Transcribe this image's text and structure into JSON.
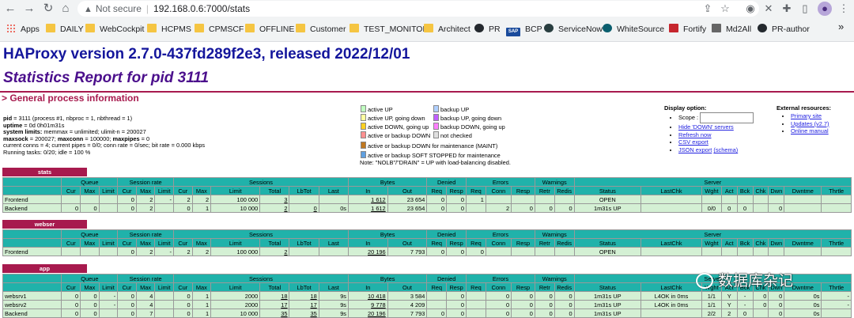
{
  "browser": {
    "back_icon": "arrow-left-icon",
    "url_scheme_warning": "Not secure",
    "url": "192.168.0.6:7000/stats",
    "bookmarks": [
      {
        "label": "Apps",
        "icon": "apps-grid-icon"
      },
      {
        "label": "DAILY",
        "icon": "folder-icon"
      },
      {
        "label": "WebCockpit",
        "icon": "folder-icon"
      },
      {
        "label": "HCPMS",
        "icon": "folder-icon"
      },
      {
        "label": "CPMSCF",
        "icon": "folder-icon"
      },
      {
        "label": "OFFLINE",
        "icon": "folder-icon"
      },
      {
        "label": "Customer",
        "icon": "folder-icon"
      },
      {
        "label": "TEST_MONITOR",
        "icon": "folder-icon"
      },
      {
        "label": "Architect",
        "icon": "folder-icon"
      },
      {
        "label": "PR",
        "icon": "github-icon"
      },
      {
        "label": "BCP",
        "icon": "sap-icon"
      },
      {
        "label": "ServiceNow",
        "icon": "servicenow-icon"
      },
      {
        "label": "WhiteSource",
        "icon": "whitesource-icon"
      },
      {
        "label": "Fortify",
        "icon": "fortify-icon"
      },
      {
        "label": "Md2All",
        "icon": "md2all-icon"
      },
      {
        "label": "PR-author",
        "icon": "github-icon"
      }
    ],
    "more_bookmarks": "»",
    "sap_label": "SAP"
  },
  "page": {
    "title": "HAProxy version 2.7.0-437fd289f2e3, released 2022/12/01",
    "subtitle": "Statistics Report for pid 3111",
    "section_title": "> General process information"
  },
  "process_info": {
    "line1_key": "pid",
    "line1_val": " = 3111 (process #1, nbproc = 1, nbthread = 1)",
    "line2_key": "uptime",
    "line2_val": " = 0d 0h01m31s",
    "line3_key": "system limits:",
    "line3_val": " memmax = unlimited; ulimit-n = 200027",
    "line4_key1": "maxsock",
    "line4_val1": " = 200027; ",
    "line4_key2": "maxconn",
    "line4_val2": " = 100000; ",
    "line4_key3": "maxpipes",
    "line4_val3": " = 0",
    "line5": "current conns = 4; current pipes = 0/0; conn rate = 0/sec; bit rate = 0.000 kbps",
    "line6": "Running tasks: 0/20; idle = 100 %"
  },
  "legend": {
    "items": [
      {
        "label": "active UP",
        "color": "#c0ffc0"
      },
      {
        "label": "backup UP",
        "color": "#b0d0ff"
      },
      {
        "label": "active UP, going down",
        "color": "#ffffa0"
      },
      {
        "label": "backup UP, going down",
        "color": "#c060ff"
      },
      {
        "label": "active DOWN, going up",
        "color": "#ffd020"
      },
      {
        "label": "backup DOWN, going up",
        "color": "#ff80ff"
      },
      {
        "label": "active or backup DOWN",
        "color": "#ff9090"
      },
      {
        "label": "not checked",
        "color": "#e0e0e0"
      },
      {
        "label": "active or backup DOWN for maintenance (MAINT)",
        "color": "#c07820"
      },
      {
        "label": "active or backup SOFT STOPPED for maintenance",
        "color": "#60a0e0"
      }
    ],
    "note": "Note: \"NOLB\"/\"DRAIN\" = UP with load-balancing disabled."
  },
  "display_options": {
    "title": "Display option:",
    "scope_label": "Scope :",
    "links": [
      "Hide 'DOWN' servers",
      "Refresh now",
      "CSV export",
      "JSON export"
    ],
    "schema_link": "(schema)"
  },
  "external_resources": {
    "title": "External resources:",
    "links": [
      "Primary site",
      "Updates (v2.7)",
      "Online manual"
    ]
  },
  "table_headers": {
    "groups": [
      "Queue",
      "Session rate",
      "Sessions",
      "Bytes",
      "Denied",
      "Errors",
      "Warnings",
      "Server"
    ],
    "cols": [
      "Cur",
      "Max",
      "Limit",
      "Cur",
      "Max",
      "Limit",
      "Cur",
      "Max",
      "Limit",
      "Total",
      "LbTot",
      "Last",
      "In",
      "Out",
      "Req",
      "Resp",
      "Req",
      "Conn",
      "Resp",
      "Retr",
      "Redis",
      "Status",
      "LastChk",
      "Wght",
      "Act",
      "Bck",
      "Chk",
      "Dwn",
      "Dwntme",
      "Thrtle"
    ]
  },
  "proxies": [
    {
      "name": "stats",
      "rows": [
        {
          "kind": "fe",
          "cells": [
            "Frontend",
            "",
            "",
            "",
            "0",
            "2",
            "-",
            "2",
            "2",
            "100 000",
            "3",
            "",
            "",
            "1 612",
            "23 654",
            "0",
            "0",
            "1",
            "",
            "",
            "",
            "",
            "OPEN",
            "",
            "",
            "",
            "",
            "",
            "",
            "",
            ""
          ]
        },
        {
          "kind": "be",
          "cells": [
            "Backend",
            "0",
            "0",
            "",
            "0",
            "2",
            "",
            "0",
            "1",
            "10 000",
            "2",
            "0",
            "0s",
            "1 612",
            "23 654",
            "0",
            "0",
            "",
            "2",
            "0",
            "0",
            "0",
            "1m31s UP",
            "",
            "0/0",
            "0",
            "0",
            "",
            "0",
            "",
            ""
          ]
        }
      ]
    },
    {
      "name": "webser",
      "rows": [
        {
          "kind": "fe",
          "cells": [
            "Frontend",
            "",
            "",
            "",
            "0",
            "2",
            "-",
            "2",
            "2",
            "100 000",
            "2",
            "",
            "",
            "20 196",
            "7 793",
            "0",
            "0",
            "0",
            "",
            "",
            "",
            "",
            "OPEN",
            "",
            "",
            "",
            "",
            "",
            "",
            "",
            ""
          ]
        }
      ]
    },
    {
      "name": "app",
      "rows": [
        {
          "kind": "be",
          "cells": [
            "websrv1",
            "0",
            "0",
            "-",
            "0",
            "4",
            "",
            "0",
            "1",
            "2000",
            "18",
            "18",
            "9s",
            "10 418",
            "3 584",
            "",
            "0",
            "",
            "0",
            "0",
            "0",
            "0",
            "1m31s UP",
            "L4OK in 0ms",
            "1/1",
            "Y",
            "-",
            "0",
            "0",
            "0s",
            "-"
          ]
        },
        {
          "kind": "be",
          "cells": [
            "websrv2",
            "0",
            "0",
            "-",
            "0",
            "4",
            "",
            "0",
            "1",
            "2000",
            "17",
            "17",
            "9s",
            "9 778",
            "4 209",
            "",
            "0",
            "",
            "0",
            "0",
            "0",
            "0",
            "1m31s UP",
            "L4OK in 0ms",
            "1/1",
            "Y",
            "-",
            "0",
            "0",
            "0s",
            "-"
          ]
        },
        {
          "kind": "be",
          "cells": [
            "Backend",
            "0",
            "0",
            "",
            "0",
            "7",
            "",
            "0",
            "1",
            "10 000",
            "35",
            "35",
            "9s",
            "20 196",
            "7 793",
            "0",
            "0",
            "",
            "0",
            "0",
            "0",
            "0",
            "1m31s UP",
            "",
            "2/2",
            "2",
            "0",
            "",
            "0",
            "0s",
            ""
          ]
        }
      ]
    }
  ],
  "watermark": "数据库杂记"
}
